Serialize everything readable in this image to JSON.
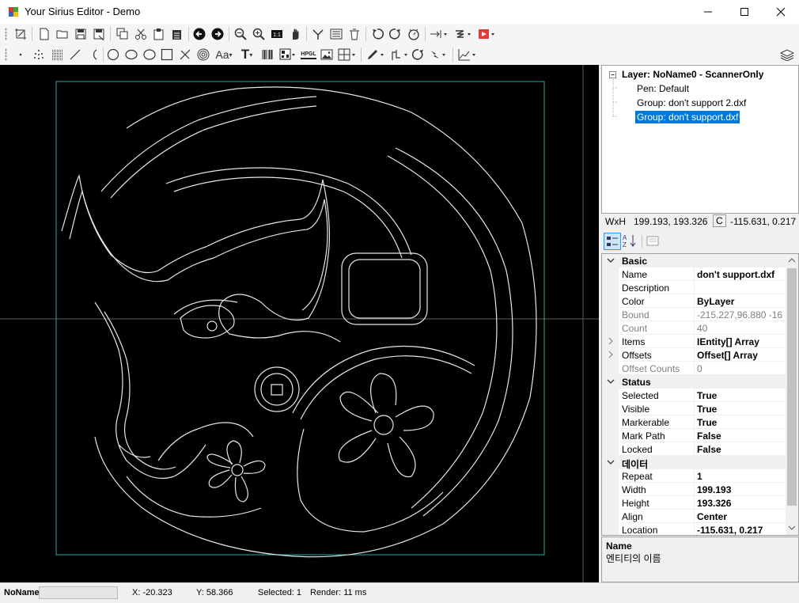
{
  "window": {
    "title": "Your Sirius Editor - Demo"
  },
  "toolbar1": [
    "crop-icon",
    "new-file-icon",
    "open-folder-icon",
    "save-icon",
    "save-as-icon",
    "copy-icon",
    "cut-icon",
    "paste-icon",
    "paste-array-icon",
    "arrow-left-icon",
    "arrow-right-icon",
    "zoom-out-icon",
    "zoom-in-icon",
    "zoom-one-icon",
    "pan-hand-icon",
    "node-edit-icon",
    "list-icon",
    "delete-icon",
    "rotate-ccw-icon",
    "rotate-cw-icon",
    "timer-icon",
    "align-icon",
    "split-icon",
    "laser-run-icon"
  ],
  "toolbar2": [
    "point-icon",
    "point-cloud-icon",
    "raster-icon",
    "line-icon",
    "arc-icon",
    "circle-icon",
    "ellipse-icon",
    "rectangle-icon",
    "trepan-icon",
    "spiral-icon",
    "text-icon",
    "bold-text-icon",
    "barcode-icon",
    "qrcode-icon",
    "hpgl-icon",
    "image-icon",
    "grid-icon",
    "pen-icon",
    "marker-icon",
    "rotate-icon",
    "laser-icon",
    "chart-icon",
    "layers-icon"
  ],
  "toolbar_labels": {
    "text": "Aa",
    "bold_text": "T",
    "hpgl": "HPGL"
  },
  "tree": {
    "layer": "Layer: NoName0 - ScannerOnly",
    "pen": "Pen: Default",
    "group1": "Group: don't support 2.dxf",
    "group2": "Group: don't support.dxf"
  },
  "sizebar": {
    "wxh_label": "WxH",
    "wxh_value": "199.193, 193.326",
    "c_label": "C",
    "c_value": "-115.631, 0.217"
  },
  "properties": [
    {
      "type": "category",
      "name": "Basic"
    },
    {
      "name": "Name",
      "value": "don't support.dxf"
    },
    {
      "name": "Description",
      "value": ""
    },
    {
      "name": "Color",
      "value": "ByLayer"
    },
    {
      "name": "Bound",
      "value": "-215.227,96.880 -16",
      "readonly": true
    },
    {
      "name": "Count",
      "value": "40",
      "readonly": true
    },
    {
      "name": "Items",
      "value": "IEntity[] Array",
      "expandable": true
    },
    {
      "name": "Offsets",
      "value": "Offset[] Array",
      "expandable": true
    },
    {
      "name": "Offset Counts",
      "value": "0",
      "readonly": true
    },
    {
      "type": "category",
      "name": "Status"
    },
    {
      "name": "Selected",
      "value": "True"
    },
    {
      "name": "Visible",
      "value": "True"
    },
    {
      "name": "Markerable",
      "value": "True"
    },
    {
      "name": "Mark Path",
      "value": "False"
    },
    {
      "name": "Locked",
      "value": "False"
    },
    {
      "type": "category",
      "name": "데이터"
    },
    {
      "name": "Repeat",
      "value": "1"
    },
    {
      "name": "Width",
      "value": "199.193"
    },
    {
      "name": "Height",
      "value": "193.326"
    },
    {
      "name": "Align",
      "value": "Center"
    },
    {
      "name": "Location",
      "value": "-115.631, 0.217"
    }
  ],
  "help": {
    "title": "Name",
    "desc": "엔티티의 이름"
  },
  "status": {
    "name": "NoName",
    "x": "X: -20.323",
    "y": "Y: 58.366",
    "selected": "Selected: 1",
    "render": "Render: 11 ms"
  },
  "colors": {
    "selection": "#0078d7",
    "boundary": "#2aa8a8",
    "canvas": "#000000"
  }
}
